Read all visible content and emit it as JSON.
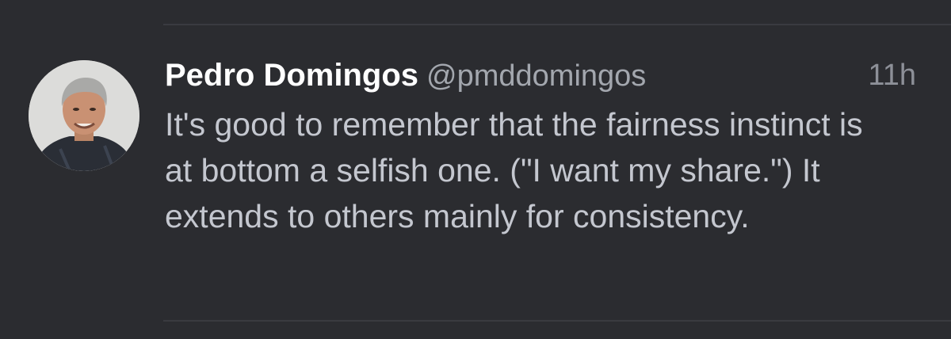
{
  "tweet": {
    "author": {
      "display_name": "Pedro Domingos",
      "handle": "@pmddomingos",
      "avatar_icon": "profile-photo"
    },
    "timestamp": "11h",
    "text": "It's good to remember that the fairness instinct is at bottom a selfish one. (\"I want my share.\") It extends to others mainly for consistency."
  },
  "colors": {
    "background": "#2b2c30",
    "display_name": "#ffffff",
    "handle": "#a3a7ae",
    "body_text": "#c4c7cf",
    "timestamp": "#8d9098",
    "divider": "#3a3b40"
  }
}
